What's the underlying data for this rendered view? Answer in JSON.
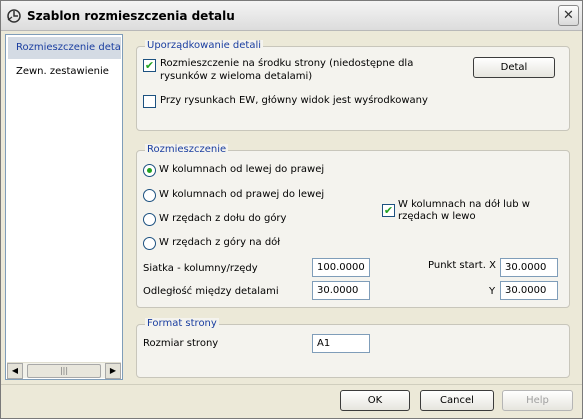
{
  "window": {
    "title": "Szablon rozmieszczenia detalu"
  },
  "nav": {
    "items": [
      {
        "label": "Rozmieszczenie detali",
        "selected": true
      },
      {
        "label": "Zewn. zestawienie",
        "selected": false
      }
    ],
    "scroll_thumb": "|||"
  },
  "group_detail": {
    "title": "Uporządkowanie detali",
    "center_check": {
      "label_line1": "Rozmieszczenie na środku strony (niedostępne dla",
      "label_line2": "rysunków z wieloma detalami)",
      "checked": true
    },
    "ew_check": {
      "label": "Przy rysunkach EW, główny widok jest wyśrodkowany",
      "checked": false
    },
    "detail_button": "Detal"
  },
  "group_layout": {
    "title": "Rozmieszczenie",
    "radios": [
      {
        "label": "W kolumnach od lewej do prawej",
        "selected": true
      },
      {
        "label": "W kolumnach od prawej do lewej",
        "selected": false
      },
      {
        "label": "W rzędach z dołu do góry",
        "selected": false
      },
      {
        "label": "W rzędach z góry na dół",
        "selected": false
      }
    ],
    "down_left_check": {
      "label_line1": "W kolumnach na dół lub w",
      "label_line2": "rzędach w lewo",
      "checked": true
    },
    "grid_label": "Siatka - kolumny/rzędy",
    "grid_value": "100.0000",
    "distance_label": "Odległość między detalami",
    "distance_value": "30.0000",
    "start_x_label": "Punkt start. X",
    "start_x_value": "30.0000",
    "start_y_label": "Y",
    "start_y_value": "30.0000"
  },
  "group_page": {
    "title": "Format strony",
    "size_label": "Rozmiar strony",
    "size_value": "A1"
  },
  "footer": {
    "ok": "OK",
    "cancel": "Cancel",
    "help": "Help"
  }
}
